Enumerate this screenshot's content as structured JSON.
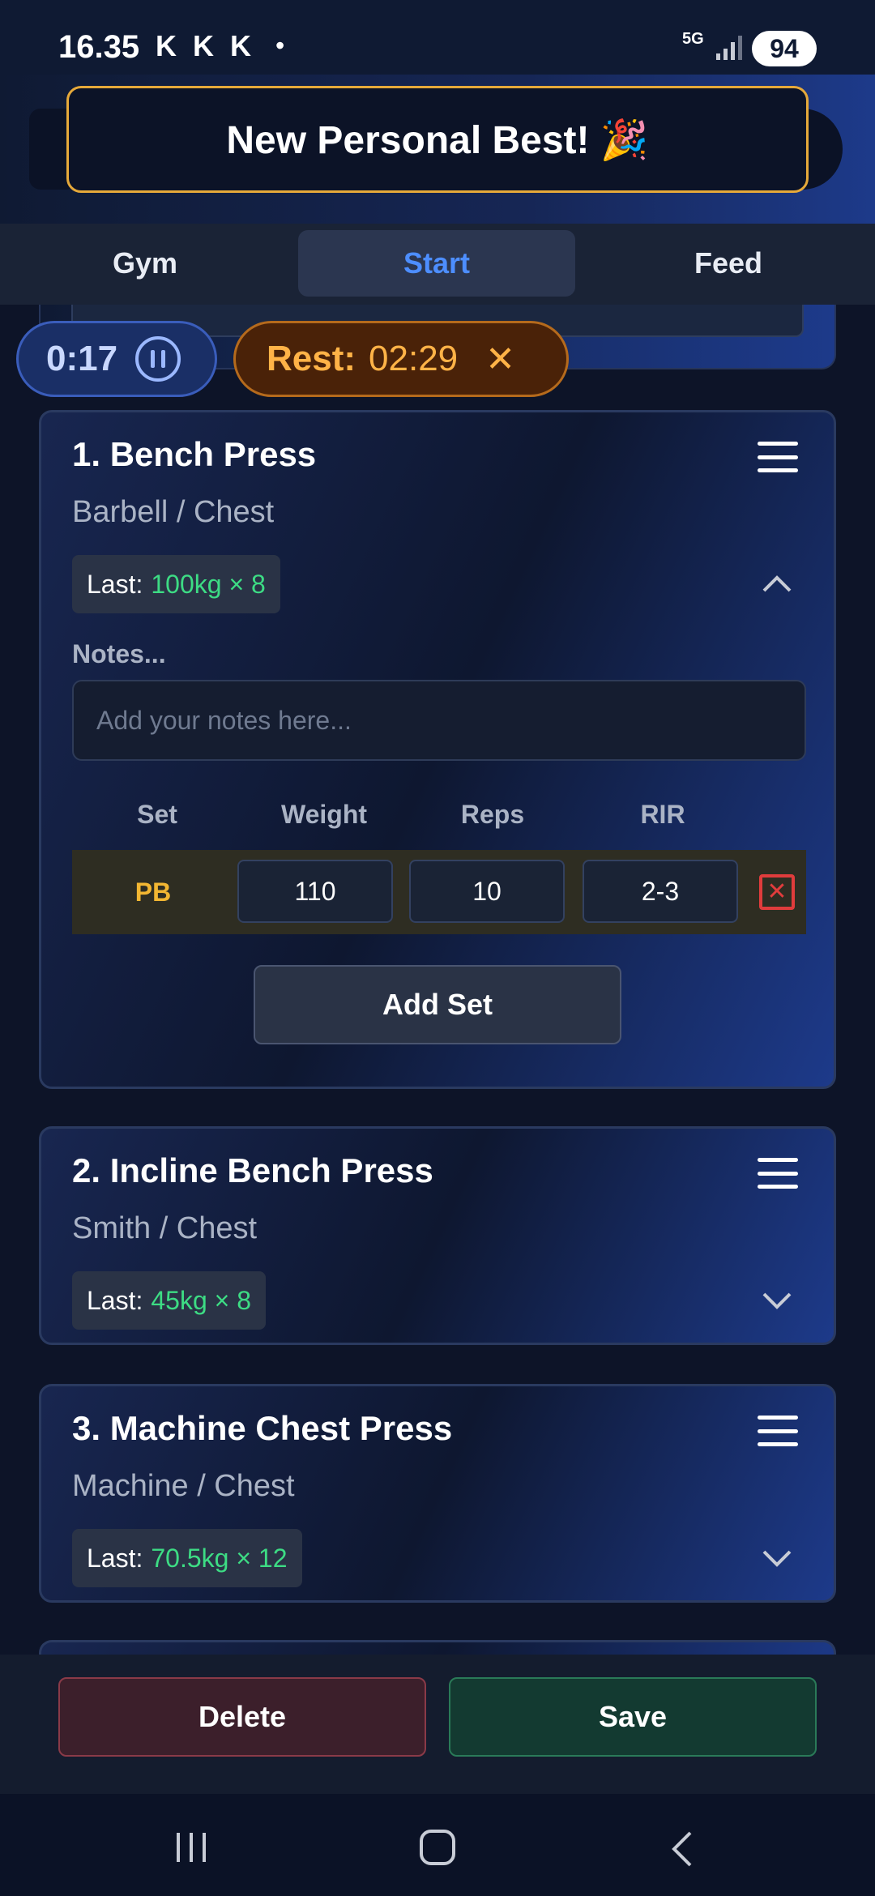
{
  "status_bar": {
    "time": "16.35",
    "notification_icons": [
      "K",
      "K",
      "K"
    ],
    "dot": "•",
    "network": "5G",
    "battery": "94"
  },
  "toast": {
    "text": "New Personal Best! 🎉"
  },
  "tabs": [
    {
      "label": "Gym",
      "active": false
    },
    {
      "label": "Start",
      "active": true
    },
    {
      "label": "Feed",
      "active": false
    }
  ],
  "workout_timer": {
    "elapsed": "0:17"
  },
  "rest_timer": {
    "label": "Rest:",
    "value": "02:29"
  },
  "exercises": [
    {
      "title": "1. Bench Press",
      "subtitle": "Barbell / Chest",
      "last_label": "Last:",
      "last_value": "100kg × 8",
      "expanded": true,
      "notes_label": "Notes...",
      "notes_placeholder": "Add your notes here...",
      "columns": [
        "Set",
        "Weight",
        "Reps",
        "RIR"
      ],
      "sets": [
        {
          "set": "PB",
          "weight": "110",
          "reps": "10",
          "rir": "2-3"
        }
      ],
      "add_set_label": "Add Set"
    },
    {
      "title": "2. Incline Bench Press",
      "subtitle": "Smith / Chest",
      "last_label": "Last:",
      "last_value": "45kg × 8",
      "expanded": false
    },
    {
      "title": "3. Machine Chest Press",
      "subtitle": "Machine / Chest",
      "last_label": "Last:",
      "last_value": "70.5kg × 12",
      "expanded": false
    }
  ],
  "actions": {
    "delete_label": "Delete",
    "save_label": "Save"
  },
  "colors": {
    "accent_blue": "#4d8eff",
    "last_value_green": "#3ddc84",
    "pb_gold": "#f2b632",
    "rest_orange": "#ffb347",
    "toast_border": "#e6a93a",
    "delete_red": "#e03c3c"
  },
  "icons": {
    "pause": "pause-icon",
    "close": "close-icon",
    "menu": "hamburger-menu-icon",
    "collapse": "chevron-up-icon",
    "expand": "chevron-down-icon",
    "remove_set": "x-square-icon"
  }
}
